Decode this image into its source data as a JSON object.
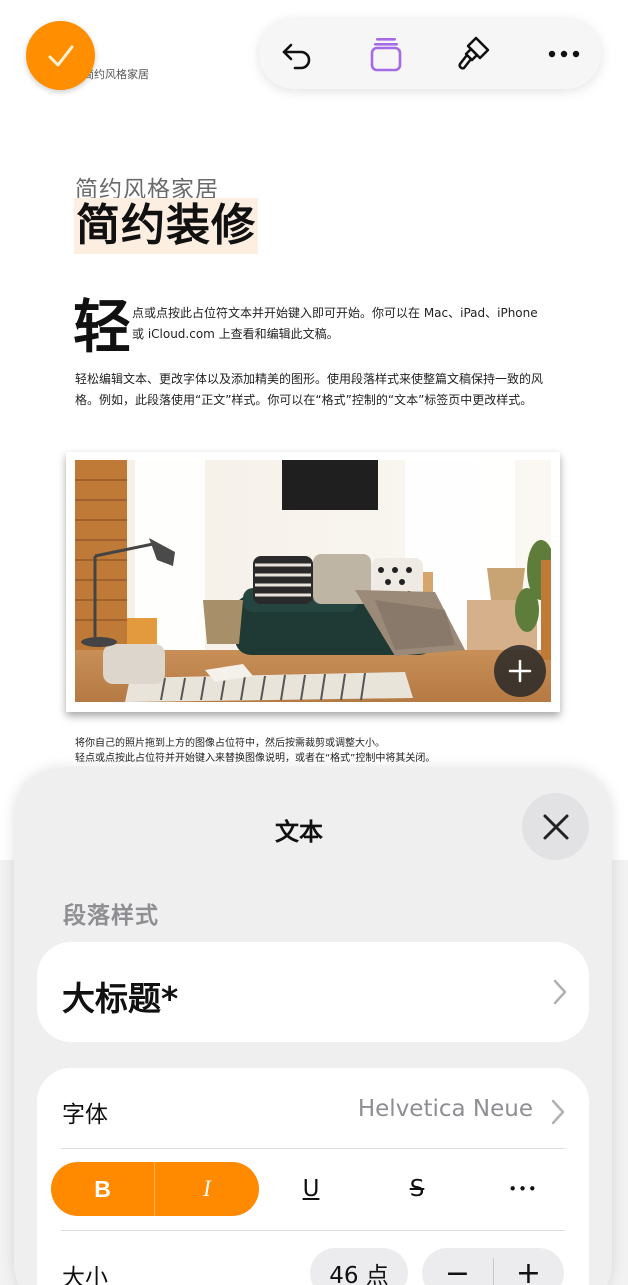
{
  "document": {
    "header_text": "简约风格家居",
    "subtitle": "简约风格家居",
    "title": "简约装修",
    "drop_cap": "轻",
    "paragraph1": "点或点按此占位符文本并开始键入即可开始。你可以在 Mac、iPad、iPhone 或 iCloud.com 上查看和编辑此文稿。",
    "paragraph2": "轻松编辑文本、更改字体以及添加精美的图形。使用段落样式来使整篇文稿保持一致的风格。例如，此段落使用“正文”样式。你可以在“格式”控制的“文本”标签页中更改样式。",
    "caption_line1": "将你自己的照片拖到上方的图像占位符中，然后按需裁剪或调整大小。",
    "caption_line2": "轻点或点按此占位符并开始键入来替换图像说明，或者在“格式”控制中将其关闭。"
  },
  "toolbar": {
    "done_icon": "checkmark-icon",
    "undo_icon": "undo-icon",
    "pages_icon": "stacked-pages-icon",
    "format_icon": "paintbrush-icon",
    "more_icon": "ellipsis-icon",
    "accent_color": "#ff8f00",
    "pages_icon_color": "#a56ae6"
  },
  "sheet": {
    "title": "文本",
    "close_icon": "close-icon",
    "paragraph_style_label": "段落样式",
    "paragraph_style_value": "大标题*",
    "font_label": "字体",
    "font_value": "Helvetica Neue",
    "bold_label": "B",
    "italic_label": "I",
    "underline_label": "U",
    "strikethrough_label": "S",
    "more_label": "•••",
    "size_label": "大小",
    "size_value": "46 点",
    "decrease_label": "−",
    "increase_label": "+"
  },
  "colors": {
    "accent": "#ff8a00",
    "title_highlight": "#fdeee2",
    "secondary_text": "#8e8e93"
  }
}
